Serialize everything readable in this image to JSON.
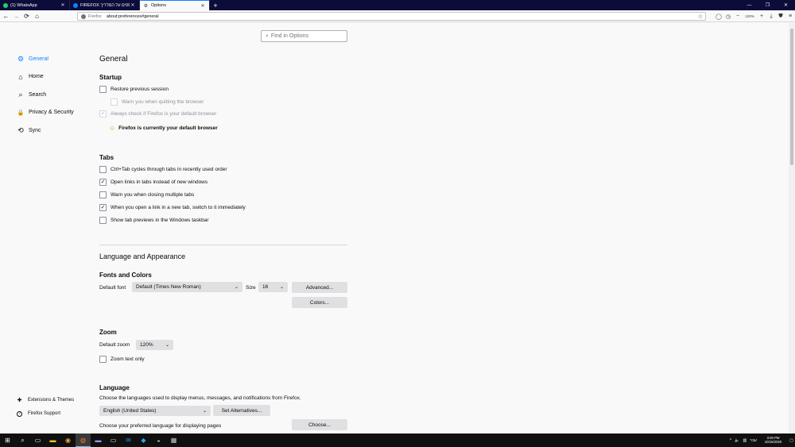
{
  "window": {
    "tabs": [
      {
        "title": "(1) WhatsApp",
        "icon": "whatsapp-icon",
        "color": "#25d366",
        "active": false
      },
      {
        "title": "FIREFOX ב תוספים על המדריך",
        "icon": "globe-icon",
        "color": "#0a84ff",
        "active": false
      },
      {
        "title": "Options",
        "icon": "gear-icon",
        "color": "#38383d",
        "active": true
      }
    ],
    "new_tab_label": "+",
    "controls": {
      "minimize": "—",
      "restore": "❐",
      "close": "✕"
    }
  },
  "navbar": {
    "back": "←",
    "forward": "→",
    "reload": "⟳",
    "home": "⌂",
    "url_brand": "Firefox",
    "url": "about:preferences#general",
    "zoom": "120%",
    "zoom_minus": "−",
    "zoom_plus": "+"
  },
  "search": {
    "placeholder": "Find in Options",
    "icon": "magnifier-icon"
  },
  "sidebar": {
    "categories": [
      {
        "label": "General",
        "icon": "gear-icon",
        "glyph": "⚙",
        "active": true
      },
      {
        "label": "Home",
        "icon": "home-icon",
        "glyph": "⌂",
        "active": false
      },
      {
        "label": "Search",
        "icon": "search-icon",
        "glyph": "⌕",
        "active": false
      },
      {
        "label": "Privacy & Security",
        "icon": "lock-icon",
        "glyph": "🔒",
        "active": false
      },
      {
        "label": "Sync",
        "icon": "sync-icon",
        "glyph": "⟲",
        "active": false
      }
    ],
    "footer": [
      {
        "label": "Extensions & Themes",
        "icon": "puzzle-icon",
        "glyph": "✚"
      },
      {
        "label": "Firefox Support",
        "icon": "help-icon",
        "glyph": "?"
      }
    ]
  },
  "main": {
    "title": "General",
    "startup": {
      "heading": "Startup",
      "restore_session": "Restore previous session",
      "warn_quit": "Warn you when quitting the browser",
      "always_check_default": "Always check if Firefox is your default browser",
      "default_browser_status": "Firefox is currently your default browser",
      "status_emoji": "☺"
    },
    "tabs": {
      "heading": "Tabs",
      "items": [
        {
          "label": "Ctrl+Tab cycles through tabs in recently used order",
          "checked": false
        },
        {
          "label": "Open links in tabs instead of new windows",
          "checked": true
        },
        {
          "label": "Warn you when closing multiple tabs",
          "checked": false
        },
        {
          "label": "When you open a link in a new tab, switch to it immediately",
          "checked": true
        },
        {
          "label": "Show tab previews in the Windows taskbar",
          "checked": false
        }
      ]
    },
    "language_appearance": {
      "heading": "Language and Appearance",
      "fonts_heading": "Fonts and Colors",
      "default_font_label": "Default font",
      "default_font_value": "Default (Times New Roman)",
      "size_label": "Size",
      "size_value": "16",
      "advanced_button": "Advanced...",
      "colors_button": "Colors..."
    },
    "zoom": {
      "heading": "Zoom",
      "default_zoom_label": "Default zoom",
      "default_zoom_value": "120%",
      "zoom_text_only": "Zoom text only"
    },
    "language": {
      "heading": "Language",
      "description": "Choose the languages used to display menus, messages, and notifications from Firefox.",
      "language_value": "English (United States)",
      "set_alternatives_button": "Set Alternatives...",
      "preferred_label": "Choose your preferred language for displaying pages",
      "choose_button": "Choose..."
    }
  },
  "taskbar": {
    "items": [
      {
        "name": "start-icon",
        "glyph": "⊞"
      },
      {
        "name": "search-icon",
        "glyph": "⌕"
      },
      {
        "name": "task-view-icon",
        "glyph": "▭"
      },
      {
        "name": "file-explorer-icon",
        "glyph": "▬"
      },
      {
        "name": "chrome-icon",
        "glyph": "◉"
      },
      {
        "name": "firefox-icon",
        "glyph": "◍"
      },
      {
        "name": "app-icon",
        "glyph": "▬"
      },
      {
        "name": "terminal-icon",
        "glyph": "▭"
      },
      {
        "name": "outlook-icon",
        "glyph": "✉"
      },
      {
        "name": "vscode-icon",
        "glyph": "◆"
      },
      {
        "name": "app2-icon",
        "glyph": "◒"
      },
      {
        "name": "calculator-icon",
        "glyph": "▦"
      }
    ],
    "tray": {
      "chevron": "^",
      "volume": "🔈",
      "network": "▥",
      "lang": "עבר",
      "time": "3:00 PM",
      "date": "10/16/2020",
      "notification": "▢"
    }
  }
}
